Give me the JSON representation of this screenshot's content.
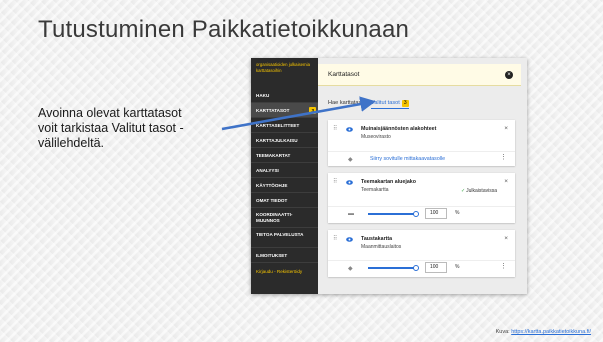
{
  "slide": {
    "title": "Tutustuminen Paikkatietoikkunaan",
    "callout_lines": [
      "Avoinna olevat karttatasot",
      "voit tarkistaa Valitut tasot -",
      "välilehdeltä."
    ],
    "credit_label": "Kuva:",
    "credit_link": "https://kartta.paikkatietoikkuna.fi/",
    "arrow_color": "#3f73c8"
  },
  "nav": {
    "org_text": "organisaatioiden julkaisemia karttatasoihin",
    "items": [
      {
        "label": "HAKU"
      },
      {
        "label": "KARTTATASOT",
        "count": "3"
      },
      {
        "label": "KARTTASELITTEET"
      },
      {
        "label": "KARTTAJULKAISU"
      },
      {
        "label": "TEEMAKARTAT"
      },
      {
        "label": "ANALYYSI"
      },
      {
        "label": "KÄYTTÖOHJE"
      },
      {
        "label": "OMAT TIEDOT"
      },
      {
        "label": "KOORDINAATTI-MUUNNOS"
      },
      {
        "label": "TIETOA PALVELUSTA"
      },
      {
        "label": "ILMOITUKSET"
      }
    ],
    "login_link": "Kirjaudu - Rekisteröidy"
  },
  "panel": {
    "title": "Karttatasot",
    "close_icon": "close-icon",
    "tabs": [
      {
        "label": "Hae karttatasoja"
      },
      {
        "label": "Valitut tasot",
        "badge": "3"
      }
    ],
    "layers": [
      {
        "name": "Muinaisjäännösten alakohteet",
        "source": "Museovirasto",
        "link": "Siirry sovitulle mittakaavatasolle"
      },
      {
        "name": "Teemakartan aluejako",
        "source": "Teemakartta",
        "visible_text": "Julkaistavissa",
        "opacity": "100",
        "opacity_unit": "%"
      },
      {
        "name": "Taustakartta",
        "source": "Maanmittauslaitos",
        "opacity": "100",
        "opacity_unit": "%"
      }
    ]
  }
}
